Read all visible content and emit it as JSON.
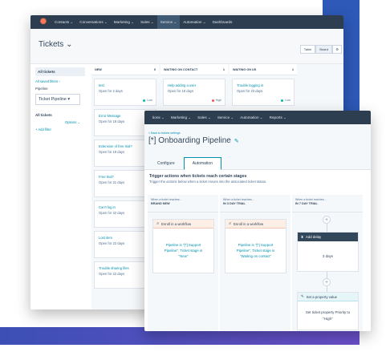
{
  "colors": {
    "nav_bg": "#2d3e50",
    "accent": "#0091ae",
    "logo": "#ff7a59",
    "deco_blue": "#2e59b8",
    "deco_purple": "#6a4fc8"
  },
  "back_window": {
    "nav": {
      "items": [
        "Contacts",
        "Conversations",
        "Marketing",
        "Sales",
        "Service",
        "Automation",
        "Dashboards"
      ]
    },
    "title": "Tickets",
    "view_toggle": [
      "Table",
      "Board"
    ],
    "filters": {
      "all_tickets": "All tickets",
      "all_saved": "All saved filters",
      "pipeline_label": "Pipeline",
      "pipeline_value": "Ticket Pipeline",
      "all_tickets_2": "All tickets",
      "options": "Options",
      "add_filter": "+ Add filter"
    },
    "columns": [
      {
        "name": "NEW",
        "cards": [
          {
            "title": "test",
            "sub": "Open for 2 days",
            "prio": "Low",
            "color": "#00bda5"
          },
          {
            "title": "Error Message",
            "sub": "Open for 18 days",
            "prio": "",
            "color": "#00bda5"
          },
          {
            "title": "Extension of free trial?",
            "sub": "Open for 19 days",
            "prio": "",
            "color": "#00bda5"
          },
          {
            "title": "Free trial?",
            "sub": "Open for 21 days",
            "prio": "",
            "color": "#f2545b"
          },
          {
            "title": "Can't log in",
            "sub": "Open for 22 days",
            "prio": "",
            "color": "#f2545b"
          },
          {
            "title": "Lost item",
            "sub": "Open for 22 days",
            "prio": "",
            "color": "#f2545b"
          },
          {
            "title": "Trouble sharing files",
            "sub": "Open for 22 days",
            "prio": "",
            "color": "#f2545b"
          }
        ]
      },
      {
        "name": "WAITING ON CONTACT",
        "cards": [
          {
            "title": "Help adding a user",
            "sub": "Open for 18 days",
            "prio": "High",
            "color": "#f2545b"
          }
        ]
      },
      {
        "name": "WAITING ON US",
        "cards": [
          {
            "title": "Trouble logging in",
            "sub": "Open for 23 days",
            "prio": "Low",
            "color": "#00bda5"
          }
        ]
      }
    ]
  },
  "front_window": {
    "nav": {
      "items": [
        "tions",
        "Marketing",
        "Sales",
        "Service",
        "Automation",
        "Reports"
      ]
    },
    "back_link": "< Back to tickets settings",
    "title": "[*] Onboarding Pipeline",
    "tabs": [
      "Configure",
      "Automation"
    ],
    "trigger_title": "Trigger actions when tickets reach certain stages",
    "trigger_sub": "Trigger the actions below when a ticket moves into the associated ticket status.",
    "stages": [
      {
        "small": "When a ticket reaches...",
        "name": "BRAND NEW",
        "action_head": "Enroll in a workflow",
        "action_body": "Pipeline is \"[*] Support Pipeline\", Ticket stage is \"New\""
      },
      {
        "small": "When a ticket reaches...",
        "name": "IN 3 DAY TRIAL",
        "action_head": "Enroll in a workflow",
        "action_body": "Pipeline is \"[*] Support Pipeline\", Ticket stage is \"Waiting on contact\""
      },
      {
        "small": "When a ticket reaches...",
        "name": "IN 7 DAY TRIAL",
        "delay_head": "Add delay",
        "delay_body": "3 days",
        "prop_head": "Set a property value",
        "prop_body": "Set ticket property Priority to \"High\""
      }
    ]
  }
}
